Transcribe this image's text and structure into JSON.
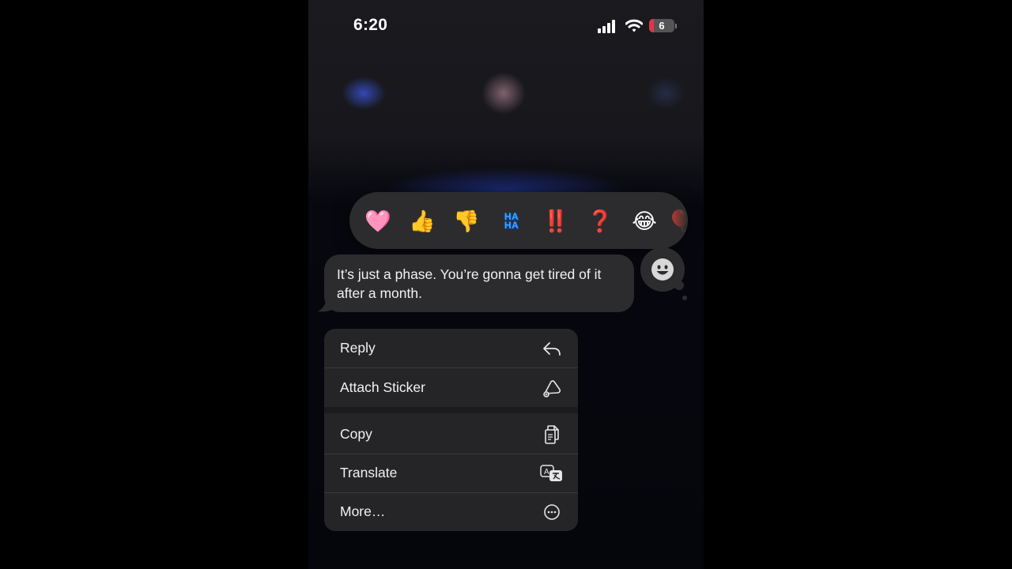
{
  "status_bar": {
    "time": "6:20",
    "battery_level": "6",
    "battery_fraction": 0.06,
    "battery_color": "#e0364a"
  },
  "reactions": [
    {
      "name": "heart",
      "glyph": "🩷"
    },
    {
      "name": "thumbs-up",
      "glyph": "👍"
    },
    {
      "name": "thumbs-down",
      "glyph": "👎"
    },
    {
      "name": "haha",
      "glyph": "HA HA"
    },
    {
      "name": "exclamation",
      "glyph": "‼️"
    },
    {
      "name": "question",
      "glyph": "❓"
    },
    {
      "name": "tears-of-joy",
      "glyph": "😂"
    },
    {
      "name": "balloon",
      "glyph": "🎈"
    }
  ],
  "message": {
    "text": "It’s just a phase. You’re gonna get tired of it after a month."
  },
  "context_menu": {
    "items": [
      {
        "label": "Reply",
        "icon": "reply-arrow-icon"
      },
      {
        "label": "Attach Sticker",
        "icon": "sticker-icon"
      },
      {
        "label": "Copy",
        "icon": "copy-icon"
      },
      {
        "label": "Translate",
        "icon": "translate-icon"
      },
      {
        "label": "More…",
        "icon": "more-ellipsis-icon"
      }
    ]
  },
  "colors": {
    "bubble": "#2c2c2e",
    "menu": "#252527"
  }
}
